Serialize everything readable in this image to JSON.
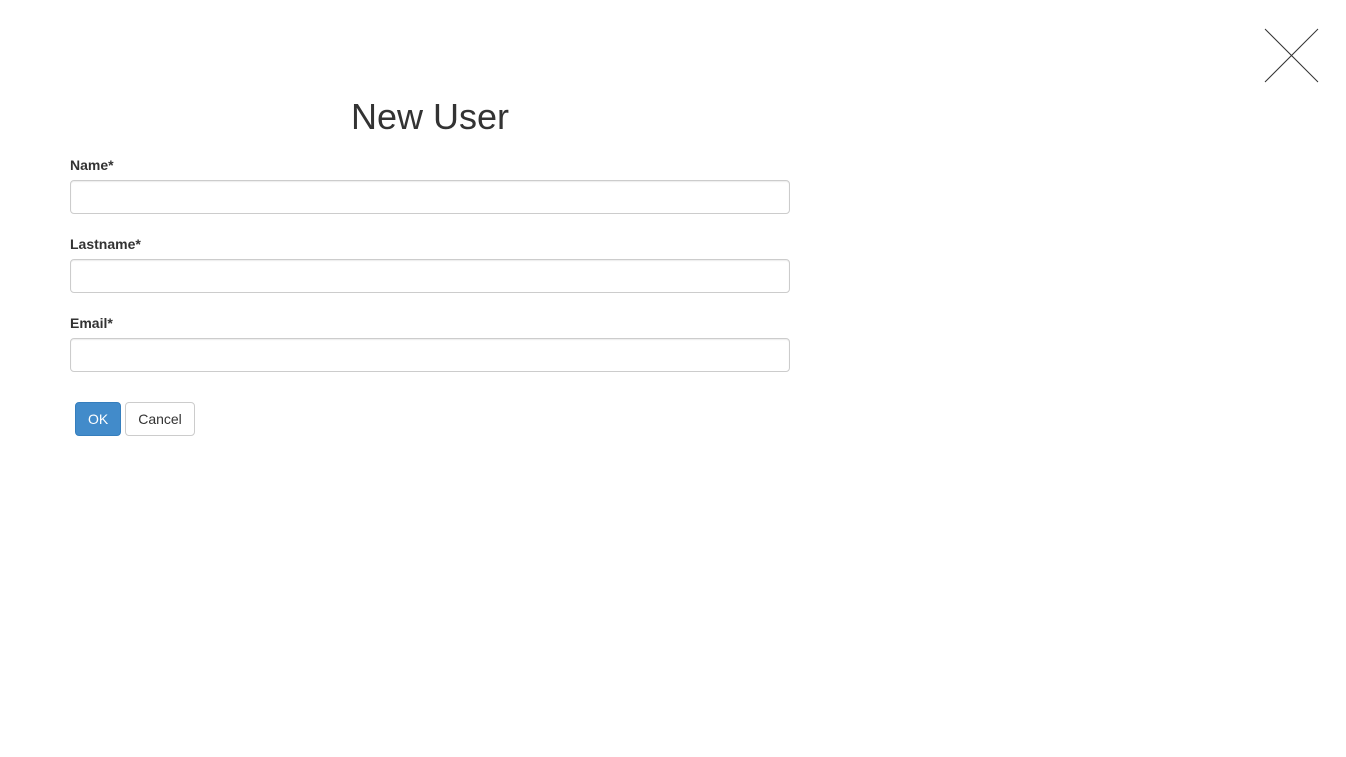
{
  "dialog": {
    "title": "New User",
    "close_icon": "close-icon"
  },
  "form": {
    "fields": [
      {
        "label": "Name*",
        "value": "",
        "placeholder": ""
      },
      {
        "label": "Lastname*",
        "value": "",
        "placeholder": ""
      },
      {
        "label": "Email*",
        "value": "",
        "placeholder": ""
      }
    ],
    "ok_label": "OK",
    "cancel_label": "Cancel"
  },
  "colors": {
    "primary": "#428bca",
    "text": "#333333",
    "border": "#cccccc"
  }
}
